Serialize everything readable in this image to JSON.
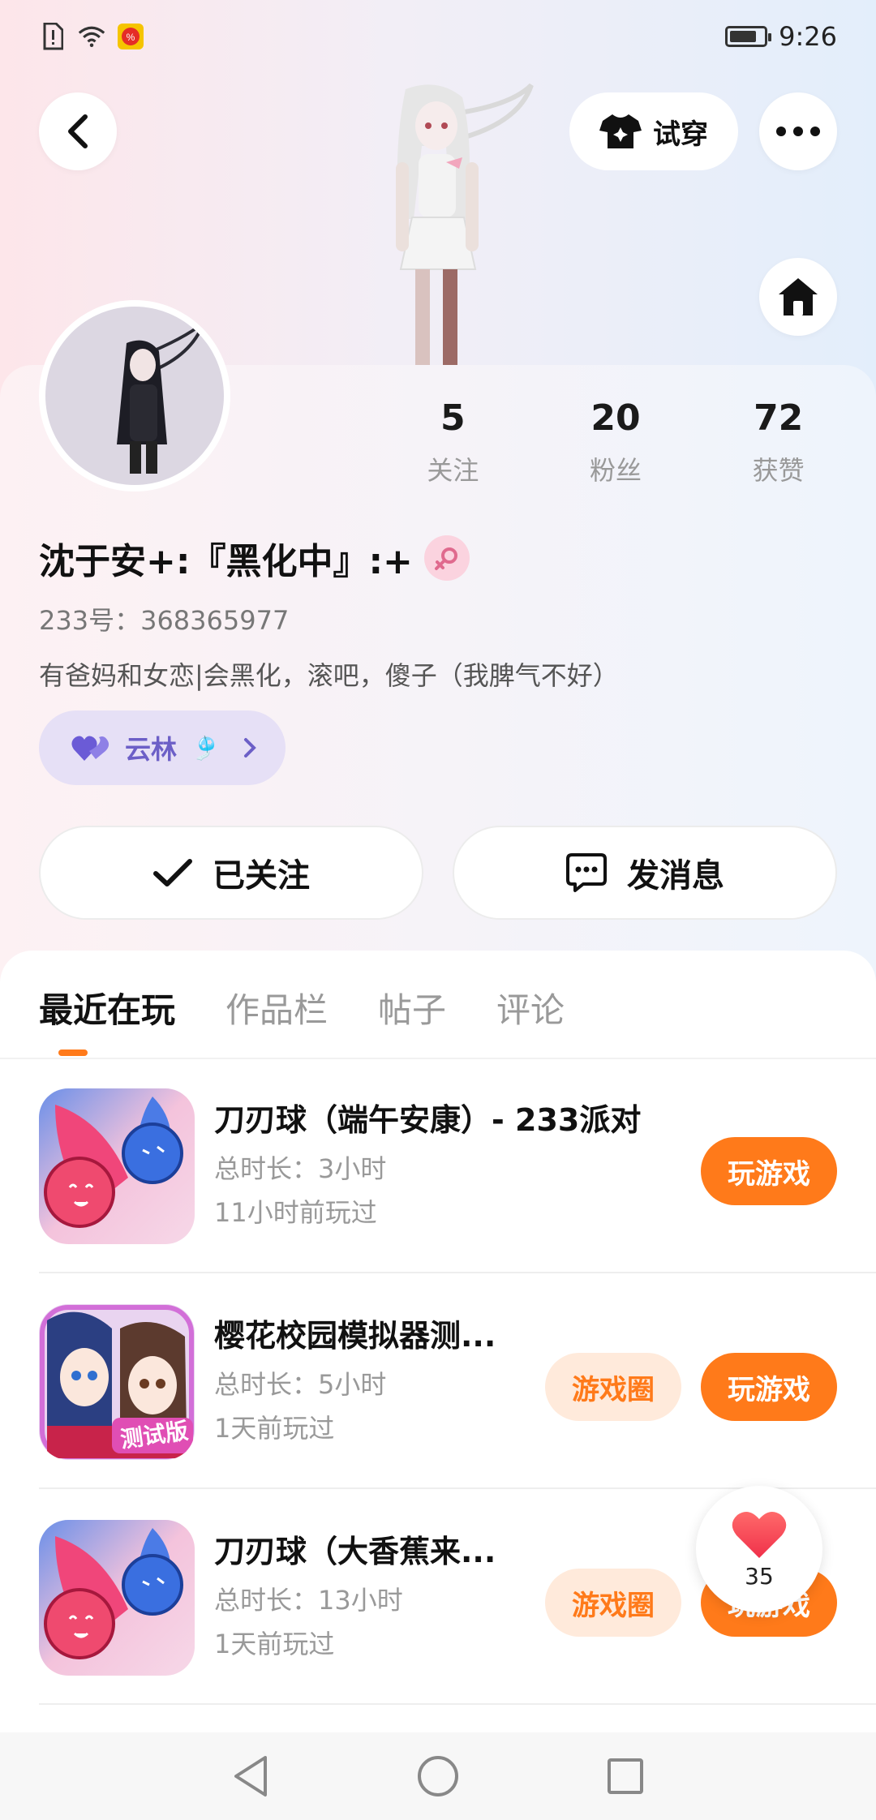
{
  "status_bar": {
    "time": "9:26"
  },
  "header": {
    "try_on_label": "试穿"
  },
  "stats": [
    {
      "value": "5",
      "label": "关注"
    },
    {
      "value": "20",
      "label": "粉丝"
    },
    {
      "value": "72",
      "label": "获赞"
    }
  ],
  "profile": {
    "username": "沈于安+:『黑化中』:+",
    "uid": "233号：368365977",
    "bio": "有爸妈和女恋|会黑化，滚吧，傻子（我脾气不好）",
    "partner_name": "云林",
    "partner_emoji": "🎐"
  },
  "actions": {
    "followed_label": "已关注",
    "message_label": "发消息"
  },
  "tabs": [
    "最近在玩",
    "作品栏",
    "帖子",
    "评论"
  ],
  "games": [
    {
      "title": "刀刃球（端午安康）- 233派对",
      "duration": "总时长：3小时",
      "last_played": "11小时前玩过",
      "play_label": "玩游戏",
      "circle_label": ""
    },
    {
      "title": "樱花校园模拟器测...",
      "duration": "总时长：5小时",
      "last_played": "1天前玩过",
      "play_label": "玩游戏",
      "circle_label": "游戏圈",
      "badge": "测试版"
    },
    {
      "title": "刀刃球（大香蕉来...",
      "duration": "总时长：13小时",
      "last_played": "1天前玩过",
      "play_label": "玩游戏",
      "circle_label": "游戏圈"
    }
  ],
  "like_float": {
    "count": "35"
  },
  "colors": {
    "accent": "#ff7a1a",
    "pill_bg": "#e6e0f6",
    "pill_text": "#6c5fc7"
  }
}
